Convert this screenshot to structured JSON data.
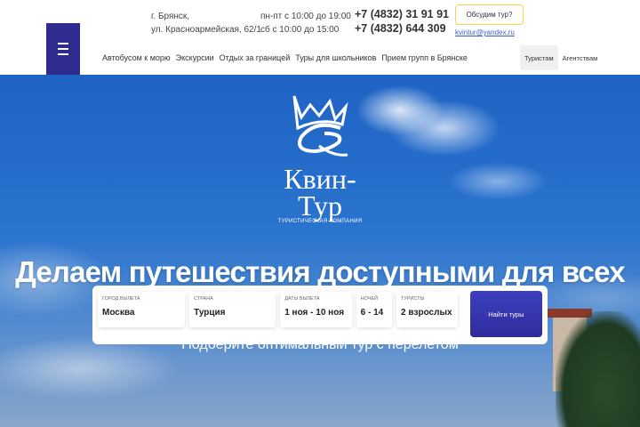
{
  "header": {
    "address": [
      "г. Брянск,",
      "ул. Красноармейская, 62/1"
    ],
    "hours": [
      "пн-пт с 10:00 до 19:00",
      "сб с 10:00 до 15:00"
    ],
    "phones": [
      "+7 (4832) 31 91 91",
      "+7 (4832) 644 309"
    ],
    "cta_label": "Обсудим тур?",
    "email": "kvintur@yandex.ru",
    "nav": [
      "Автобусом к морю",
      "Экскурсии",
      "Отдых за границей",
      "Туры для школьников",
      "Прием групп в Брянске"
    ],
    "tabs": [
      "Туристам",
      "Агентствам"
    ]
  },
  "hero": {
    "logo_name": "Квин-Тур",
    "logo_sub": "ТУРИСТИЧЕСКАЯ КОМПАНИЯ",
    "title": "Делаем путешествия доступными для всех",
    "subtitle": "Подберите оптимальный тур с перелетом"
  },
  "search": {
    "fields": [
      {
        "label": "Город вылета",
        "value": "Москва"
      },
      {
        "label": "Страна",
        "value": "Турция"
      },
      {
        "label": "Даты вылета",
        "value": "1 ноя - 10 ноя"
      },
      {
        "label": "Ночей",
        "value": "6 - 14"
      },
      {
        "label": "Туристы",
        "value": "2 взрослых"
      }
    ],
    "button": "Найти туры"
  },
  "colors": {
    "brand": "#2e2d8f",
    "cta_border": "#f2d54a"
  }
}
